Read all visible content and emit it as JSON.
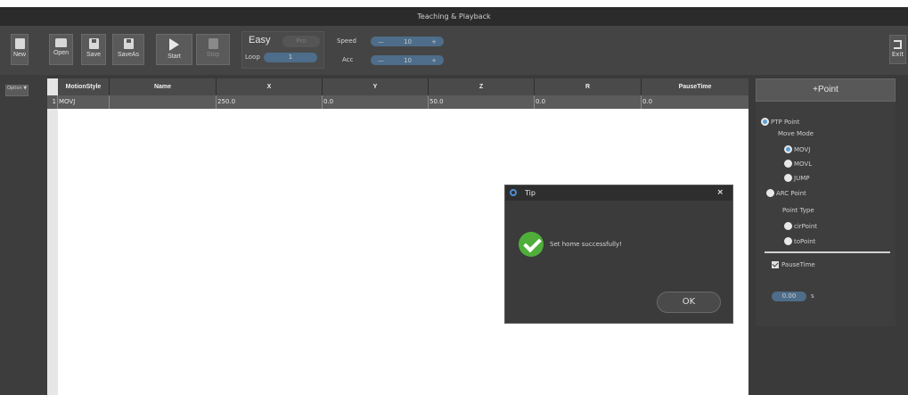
{
  "window": {
    "title": "Teaching & Playback"
  },
  "toolbar": {
    "new_label": "New",
    "open_label": "Open",
    "save_label": "Save",
    "saveas_label": "SaveAs",
    "start_label": "Start",
    "stop_label": "Stop",
    "mode_easy": "Easy",
    "mode_pro": "Pro",
    "loop_label": "Loop",
    "loop_value": "1",
    "speed_label": "Speed",
    "speed_value": "10",
    "acc_label": "Acc",
    "acc_value": "10",
    "spin_minus": "—",
    "spin_plus": "+",
    "exit_label": "Exit"
  },
  "left": {
    "option_label": "Option ▼"
  },
  "table": {
    "columns": [
      "MotionStyle",
      "Name",
      "X",
      "Y",
      "Z",
      "R",
      "PauseTime"
    ],
    "rows": [
      {
        "index": "1",
        "motion": "MOVJ",
        "name": "",
        "x": "250.0",
        "y": "0.0",
        "z": "50.0",
        "r": "0.0",
        "pause": "0.0"
      }
    ]
  },
  "panel": {
    "add_point": "+Point",
    "ptp_point": "PTP Point",
    "move_mode": "Move Mode",
    "movj": "MOVJ",
    "movl": "MOVL",
    "jump": "JUMP",
    "arc_point": "ARC Point",
    "point_type": "Point Type",
    "cir_point": "cirPoint",
    "to_point": "toPoint",
    "pause_time": "PauseTime",
    "pause_value": "0.00",
    "pause_unit": "s",
    "selected_color": "#5ba0d8"
  },
  "dialog": {
    "title": "Tip",
    "close": "×",
    "message": "Set home successfully!",
    "ok": "OK",
    "success_color": "#4fae3a"
  }
}
